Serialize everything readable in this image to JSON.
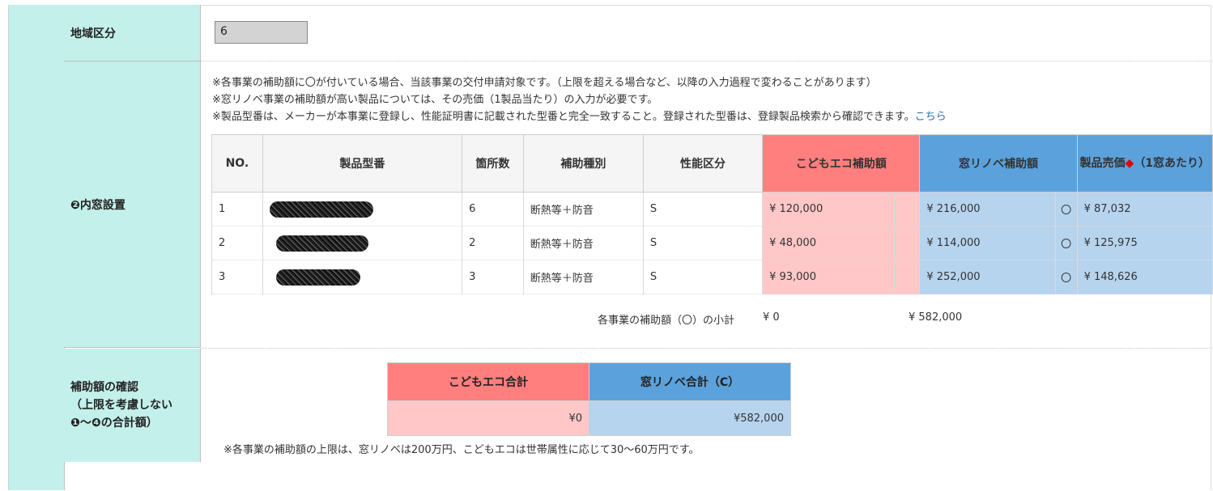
{
  "rows": {
    "area": {
      "label": "地域区分",
      "value": "6"
    },
    "inner_window": {
      "label": "❷内窓設置"
    },
    "confirm": {
      "label_line1": "補助額の確認",
      "label_line2": "（上限を考慮しない",
      "label_line3": "❶～❹の合計額）"
    }
  },
  "notes": {
    "line1": "※各事業の補助額に〇が付いている場合、当該事業の交付申請対象です。（上限を超える場合など、以降の入力過程で変わることがあります）",
    "line2": "※窓リノベ事業の補助額が高い製品については、その売価（1製品当たり）の入力が必要です。",
    "line3": "※製品型番は、メーカーが本事業に登録し、性能証明書に記載された型番と完全一致すること。登録された型番は、登録製品検索から確認できます。",
    "link": "こちら"
  },
  "product_table": {
    "headers": {
      "no": "NO.",
      "model": "製品型番",
      "count": "箇所数",
      "type": "補助種別",
      "grade": "性能区分",
      "kodomo": "こどもエコ補助額",
      "mado": "窓リノベ補助額",
      "price_line1": "製品売価",
      "price_mark": "◆",
      "price_line2": "（1窓あたり）"
    },
    "rows": [
      {
        "no": "1",
        "count": "6",
        "type": "断熱等＋防音",
        "grade": "S",
        "kodomo": "¥ 120,000",
        "kodomo_mark": "",
        "mado": "¥ 216,000",
        "mado_mark": "〇",
        "price": "¥ 87,032"
      },
      {
        "no": "2",
        "count": "2",
        "type": "断熱等＋防音",
        "grade": "S",
        "kodomo": "¥ 48,000",
        "kodomo_mark": "",
        "mado": "¥ 114,000",
        "mado_mark": "〇",
        "price": "¥ 125,975"
      },
      {
        "no": "3",
        "count": "3",
        "type": "断熱等＋防音",
        "grade": "S",
        "kodomo": "¥ 93,000",
        "kodomo_mark": "",
        "mado": "¥ 252,000",
        "mado_mark": "〇",
        "price": "¥ 148,626"
      }
    ]
  },
  "subtotal": {
    "label": "各事業の補助額（〇）の小計",
    "kodomo": "¥ 0",
    "mado": "¥ 582,000"
  },
  "totals": {
    "kodomo_header": "こどもエコ合計",
    "mado_header": "窓リノベ合計（C）",
    "kodomo_value": "¥0",
    "mado_value": "¥582,000"
  },
  "limit_note": "※各事業の補助額の上限は、窓リノベは200万円、こどもエコは世帯属性に応じて30～60万円です。",
  "colors": {
    "label_bg": "#c3f0ea",
    "kodomo_header": "#ff7f7f",
    "kodomo_cell": "#ffc7c7",
    "mado_header": "#5ba2dc",
    "mado_cell": "#b7d4ef"
  }
}
